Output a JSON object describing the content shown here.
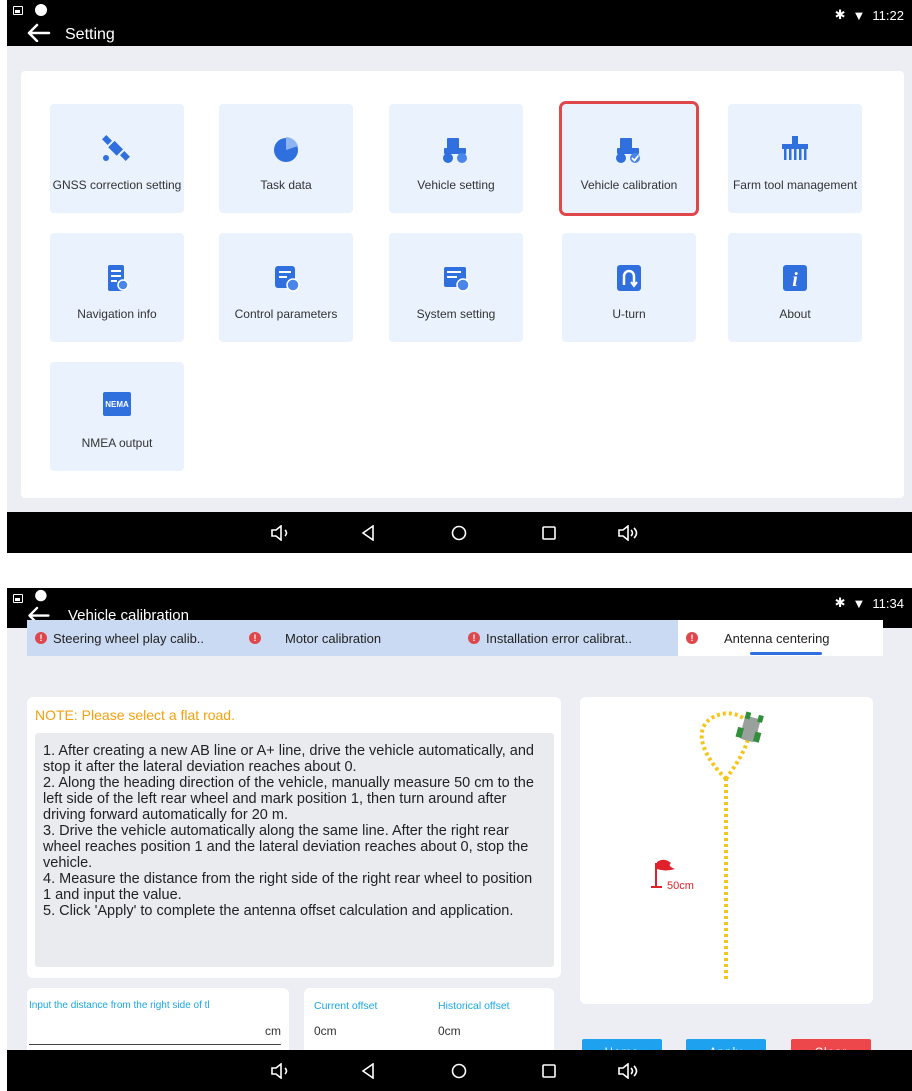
{
  "settings_screen": {
    "title": "Setting",
    "time": "11:22",
    "tiles": [
      {
        "label": "GNSS correction setting",
        "icon": "satellite-icon"
      },
      {
        "label": "Task data",
        "icon": "pie-chart-icon"
      },
      {
        "label": "Vehicle setting",
        "icon": "tractor-gear-icon"
      },
      {
        "label": "Vehicle calibration",
        "icon": "tractor-check-icon"
      },
      {
        "label": "Farm tool management",
        "icon": "farm-tool-icon"
      },
      {
        "label": "Navigation info",
        "icon": "document-info-icon"
      },
      {
        "label": "Control parameters",
        "icon": "control-settings-icon"
      },
      {
        "label": "System setting",
        "icon": "system-settings-icon"
      },
      {
        "label": "U-turn",
        "icon": "u-turn-icon"
      },
      {
        "label": "About",
        "icon": "info-icon"
      },
      {
        "label": "NMEA output",
        "icon": "nmea-icon"
      }
    ],
    "nmea_badge": "NEMA",
    "selected_tile": "Vehicle calibration"
  },
  "calibration_screen": {
    "title": "Vehicle calibration",
    "time": "11:34",
    "tabs": [
      {
        "label": "Steering wheel play calib.."
      },
      {
        "label": "Motor calibration"
      },
      {
        "label": "Installation error calibrat.."
      },
      {
        "label": "Antenna centering"
      }
    ],
    "active_tab": "Antenna centering",
    "note": "NOTE: Please select a flat road.",
    "steps": [
      "1. After creating a new AB line or A+ line, drive the vehicle automatically, and stop it after the lateral deviation reaches about 0.",
      " 2. Along the heading direction of the vehicle, manually measure 50 cm to the left side of the left rear wheel and mark position 1, then turn around after driving forward automatically for 20 m.",
      " 3. Drive the vehicle automatically along the same line. After the right rear wheel reaches position 1 and the lateral deviation reaches about 0, stop the vehicle.",
      " 4. Measure the distance from the right side of the right rear wheel to position 1 and input the value.",
      " 5. Click 'Apply' to complete the antenna offset calculation and application."
    ],
    "input": {
      "label": "Input the distance from the right side of tl",
      "unit": "cm",
      "value": ""
    },
    "current_offset": {
      "label": "Current offset",
      "value": "0cm"
    },
    "historical_offset": {
      "label": "Historical offset",
      "value": "0cm"
    },
    "diagram_label": "50cm",
    "buttons": {
      "home": "Home",
      "apply": "Apply",
      "clear": "Clear"
    },
    "colors": {
      "home": "#1ea2f0",
      "apply": "#1ea2f0",
      "clear": "#ee474b",
      "note": "#f3a10f",
      "path": "#f5c518"
    }
  }
}
